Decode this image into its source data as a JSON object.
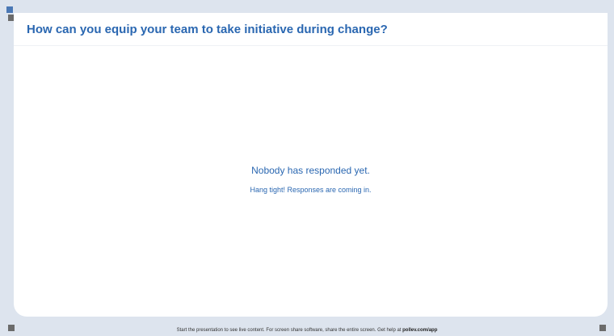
{
  "question": {
    "title": "How can you equip your team to take initiative during change?"
  },
  "empty_state": {
    "primary": "Nobody has responded yet.",
    "secondary": "Hang tight! Responses are coming in."
  },
  "footer": {
    "text": "Start the presentation to see live content. For screen share software, share the entire screen. Get help at ",
    "link": "pollev.com/app"
  },
  "colors": {
    "accent": "#2a67b1",
    "background": "#dde4ee",
    "card": "#ffffff"
  }
}
